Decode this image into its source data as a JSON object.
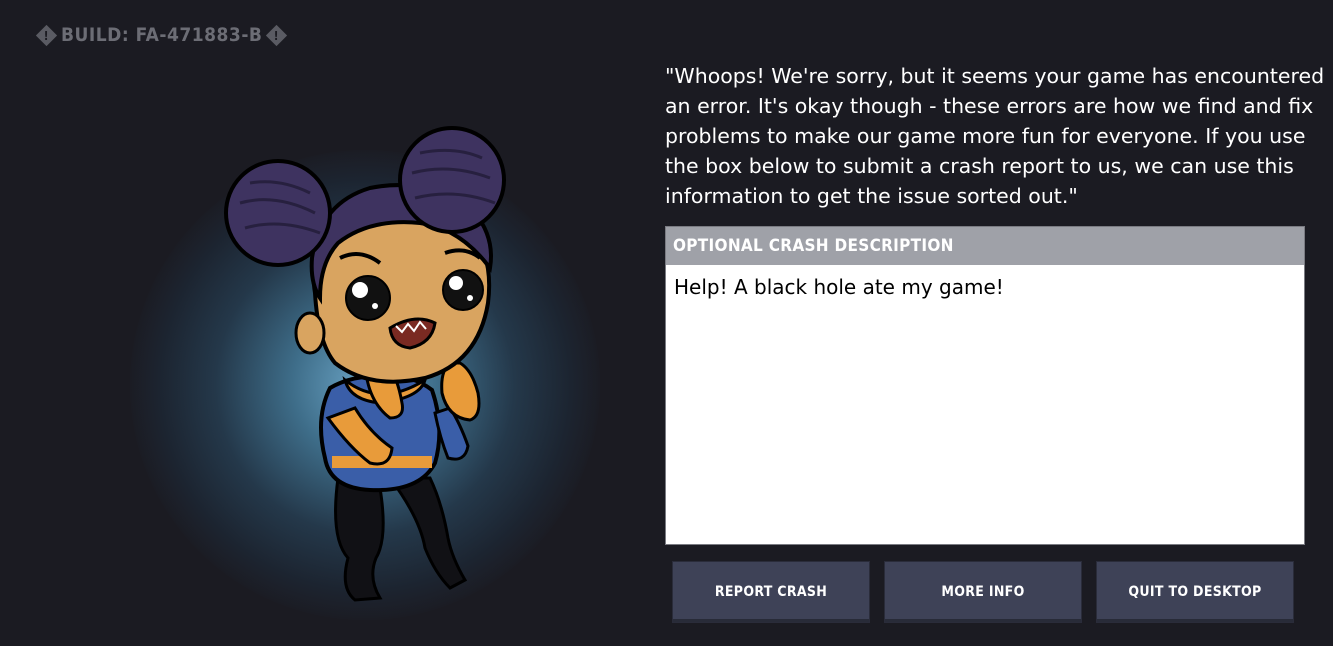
{
  "build": {
    "label": "BUILD: FA-471883-B",
    "icon_left": "exclamation-diamond-icon",
    "icon_right": "exclamation-diamond-icon",
    "icon_glyph": "!"
  },
  "message": "\"Whoops! We're sorry, but it seems your game has encountered an error. It's okay though - these errors are how we find and fix problems to make our game more fun for everyone. If you use the box below to submit a crash report to us, we can use this information to get the issue sorted out.\"",
  "crash_form": {
    "header": "OPTIONAL CRASH DESCRIPTION",
    "description_value": "Help! A black hole ate my game!"
  },
  "buttons": {
    "report": "REPORT CRASH",
    "more_info": "MORE INFO",
    "quit": "QUIT TO DESKTOP"
  },
  "colors": {
    "background": "#1b1b22",
    "button": "#3e4257",
    "header": "#9fa1a8",
    "glow": "#6aa3c4"
  }
}
